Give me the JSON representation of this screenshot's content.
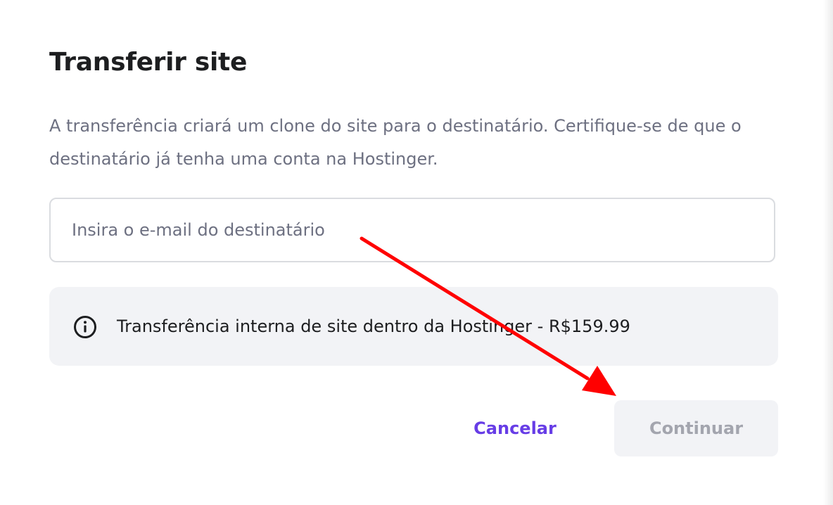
{
  "dialog": {
    "title": "Transferir site",
    "description": "A transferência criará um clone do site para o destinatário. Certifique-se de que o destinatário já tenha uma conta na Hostinger."
  },
  "email_input": {
    "value": "",
    "placeholder": "Insira o e-mail do destinatário"
  },
  "info": {
    "icon": "info-icon",
    "text": "Transferência interna de site dentro da Hostinger - R$159.99"
  },
  "actions": {
    "cancel_label": "Cancelar",
    "continue_label": "Continuar",
    "continue_enabled": false
  },
  "colors": {
    "accent": "#673de6",
    "annotation_arrow": "#ff0000",
    "disabled_button_bg": "#f2f3f6",
    "disabled_button_text": "#a3a5ae"
  }
}
